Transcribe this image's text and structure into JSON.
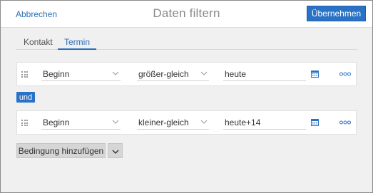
{
  "header": {
    "cancel_label": "Abbrechen",
    "title": "Daten filtern",
    "apply_label": "Übernehmen"
  },
  "tabs": [
    {
      "label": "Kontakt",
      "active": false
    },
    {
      "label": "Termin",
      "active": true
    }
  ],
  "conditions": [
    {
      "field": "Beginn",
      "operator": "größer-gleich",
      "value": "heute"
    },
    {
      "field": "Beginn",
      "operator": "kleiner-gleich",
      "value": "heute+14"
    }
  ],
  "connector_label": "und",
  "add_condition_label": "Bedingung hinzufügen",
  "icons": {
    "drag": "drag-handle-icon",
    "calendar": "calendar-icon",
    "more": "more-options-icon",
    "chevron": "chevron-down-icon"
  },
  "colors": {
    "accent": "#2a72c5",
    "link": "#2b6fb6",
    "background": "#f0f0f0"
  }
}
